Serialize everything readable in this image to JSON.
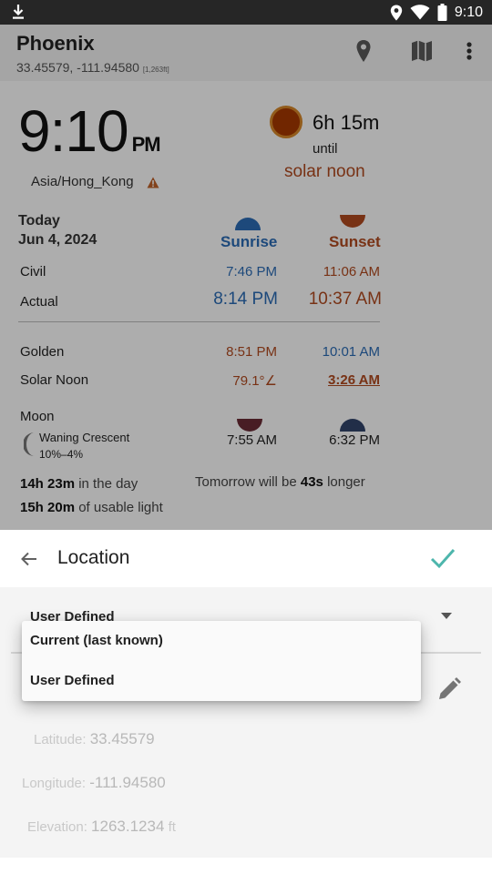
{
  "status_bar": {
    "time": "9:10",
    "icons": [
      "download-icon",
      "location-pin-icon",
      "wifi-icon",
      "battery-icon"
    ]
  },
  "app_bar": {
    "title": "Phoenix",
    "coordinates": "33.45579, -111.94580",
    "elevation_tag": "[1,263ft]",
    "icons": [
      "map-pin-icon",
      "map-icon",
      "overflow-menu-icon"
    ]
  },
  "clock": {
    "time": "9:10",
    "ampm": "PM",
    "timezone": "Asia/Hong_Kong",
    "timezone_warning_icon": "warning-icon"
  },
  "countdown": {
    "duration": "6h 15m",
    "until": "until",
    "event": "solar noon"
  },
  "table": {
    "day_label": "Today",
    "date": "Jun 4, 2024",
    "sunrise_header": "Sunrise",
    "sunset_header": "Sunset",
    "rows": [
      {
        "label": "Civil",
        "sunrise": "7:46 PM",
        "sunset": "11:06 AM"
      },
      {
        "label": "Actual",
        "sunrise": "8:14 PM",
        "sunset": "10:37 AM"
      },
      {
        "label": "Golden",
        "sunrise": "8:51 PM",
        "sunset": "10:01 AM"
      },
      {
        "label": "Solar Noon",
        "sunrise": "79.1°∠",
        "sunset": "3:26 AM"
      }
    ]
  },
  "moon": {
    "label": "Moon",
    "phase": "Waning Crescent",
    "illumination": "10%–4%",
    "moonrise": "7:55 AM",
    "moonset": "6:32 PM"
  },
  "day_length": {
    "in_day_value": "14h 23m",
    "in_day_text": " in the day",
    "usable_value": "15h 20m",
    "usable_text": " of usable light",
    "tomorrow_prefix": "Tomorrow will be ",
    "tomorrow_value": "43s",
    "tomorrow_suffix": " longer"
  },
  "sheet": {
    "title": "Location",
    "mode_selected": "User Defined",
    "mode_options": [
      "Current (last known)",
      "User Defined"
    ],
    "latitude_label": "Latitude: ",
    "latitude_value": "33.45579",
    "longitude_label": "Longitude: ",
    "longitude_value": "-111.94580",
    "elevation_label": "Elevation: ",
    "elevation_value": "1263.1234",
    "elevation_unit": " ft"
  },
  "colors": {
    "sunrise_blue": "#2b6cb6",
    "sunset_orange": "#b24a1f",
    "accept_teal": "#4db6ac"
  }
}
